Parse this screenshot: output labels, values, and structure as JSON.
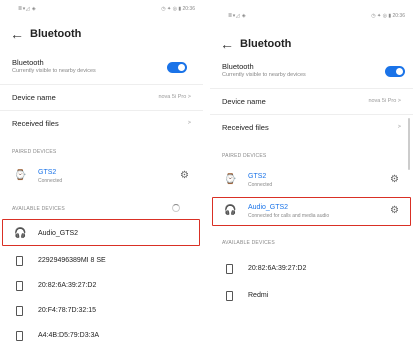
{
  "left": {
    "status_left": "≣▾◿ ◈",
    "status_right": "◷ ✦ ◎ ▮ 20:36",
    "title": "Bluetooth",
    "bluetooth_label": "Bluetooth",
    "bluetooth_sub": "Currently visible to nearby devices",
    "device_name_label": "Device name",
    "device_name_value": "nova 5i Pro >",
    "received_files_label": "Received files",
    "received_files_arrow": ">",
    "paired_section": "PAIRED DEVICES",
    "paired": [
      {
        "name": "GTS2",
        "status": "Connected"
      }
    ],
    "available_section": "AVAILABLE DEVICES",
    "available": [
      {
        "name": "Audio_GTS2",
        "icon": "headphones-icon"
      },
      {
        "name": "22929496389MI 8 SE",
        "icon": "phone-icon"
      },
      {
        "name": "20:82:6A:39:27:D2",
        "icon": "phone-icon"
      },
      {
        "name": "20:F4:78:7D:32:15",
        "icon": "phone-icon"
      },
      {
        "name": "A4:4B:D5:79:D3:3A",
        "icon": "phone-icon"
      }
    ]
  },
  "right": {
    "status_left": "≣▾◿ ◈",
    "status_right": "◷ ✦ ◎ ▮ 20:36",
    "title": "Bluetooth",
    "bluetooth_label": "Bluetooth",
    "bluetooth_sub": "Currently visible to nearby devices",
    "device_name_label": "Device name",
    "device_name_value": "nova 5i Pro >",
    "received_files_label": "Received files",
    "received_files_arrow": ">",
    "paired_section": "PAIRED DEVICES",
    "paired": [
      {
        "name": "GTS2",
        "status": "Connected"
      },
      {
        "name": "Audio_GTS2",
        "status": "Connected for calls and media audio"
      }
    ],
    "available_section": "AVAILABLE DEVICES",
    "available": [
      {
        "name": "20:82:6A:39:27:D2",
        "icon": "phone-icon"
      },
      {
        "name": "Redmi",
        "icon": "phone-icon"
      }
    ]
  },
  "colors": {
    "accent": "#1a73e8",
    "highlight": "#d93025"
  }
}
